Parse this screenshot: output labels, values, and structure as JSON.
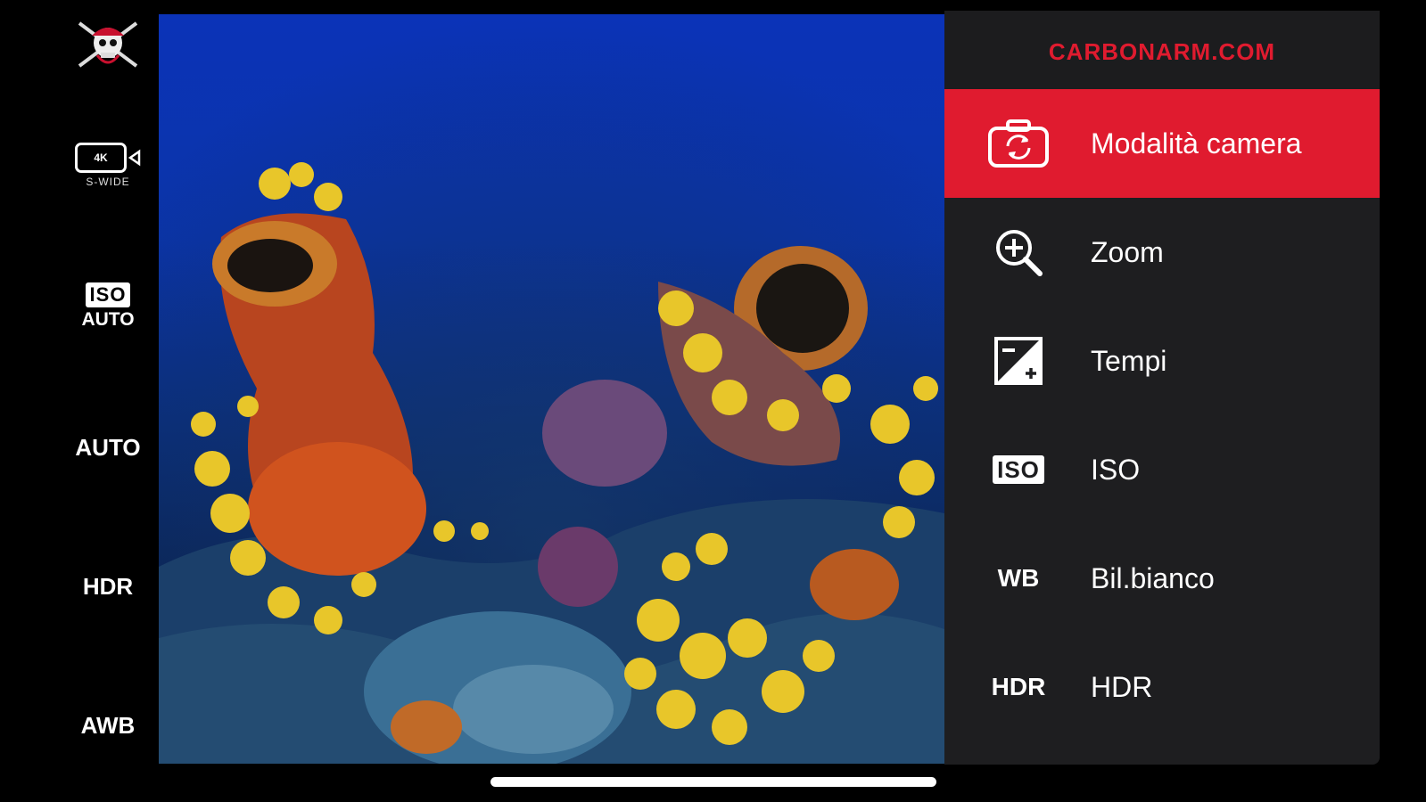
{
  "sidebar": {
    "logo_icon": "pirate-skull-logo",
    "video": {
      "resolution": "4K",
      "mode": "S-WIDE"
    },
    "iso": {
      "badge": "ISO",
      "value": "AUTO"
    },
    "auto_label": "AUTO",
    "hdr_label": "HDR",
    "awb_label": "AWB"
  },
  "menu": {
    "brand": "CARBONARM.COM",
    "items": [
      {
        "icon": "camera-switch-icon",
        "label": "Modalità camera",
        "active": true
      },
      {
        "icon": "zoom-in-icon",
        "label": "Zoom",
        "active": false
      },
      {
        "icon": "exposure-icon",
        "label": "Tempi",
        "active": false
      },
      {
        "icon": "iso-icon",
        "icon_text": "ISO",
        "label": "ISO",
        "active": false
      },
      {
        "icon": "wb-icon",
        "icon_text": "WB",
        "label": "Bil.bianco",
        "active": false
      },
      {
        "icon": "hdr-icon",
        "icon_text": "HDR",
        "label": "HDR",
        "active": false
      }
    ]
  },
  "colors": {
    "accent": "#e01b2f",
    "menu_bg": "#1e1e20",
    "background": "#000000"
  }
}
